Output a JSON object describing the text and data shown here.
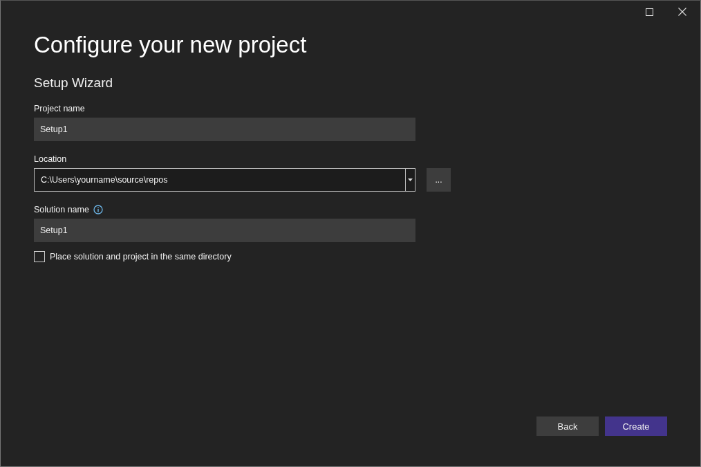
{
  "window": {
    "controls": [
      {
        "kind": "maximize"
      },
      {
        "kind": "close"
      }
    ]
  },
  "title": "Configure your new project",
  "subtitle": "Setup Wizard",
  "fields": [
    {
      "kind": "text",
      "label": "Project name",
      "value": "Setup1"
    },
    {
      "kind": "combo",
      "label": "Location",
      "value": "C:\\Users\\yourname\\source\\repos",
      "browse_label": "..."
    },
    {
      "kind": "text",
      "label": "Solution name",
      "value": "Setup1",
      "info": true
    }
  ],
  "checkbox": {
    "label": "Place solution and project in the same directory",
    "checked": false
  },
  "buttons": [
    {
      "label": "Back",
      "kind": "secondary"
    },
    {
      "label": "Create",
      "kind": "primary"
    }
  ]
}
